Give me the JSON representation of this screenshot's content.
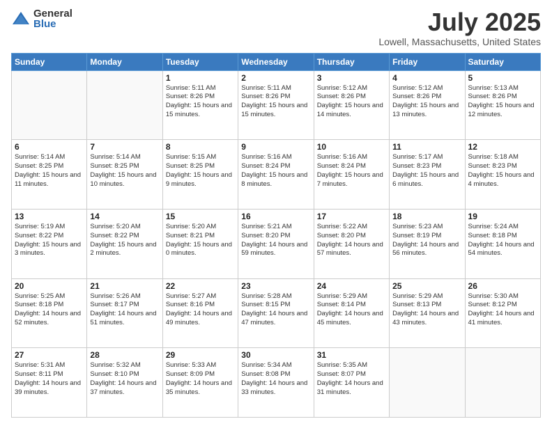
{
  "logo": {
    "general": "General",
    "blue": "Blue"
  },
  "title": "July 2025",
  "subtitle": "Lowell, Massachusetts, United States",
  "headers": [
    "Sunday",
    "Monday",
    "Tuesday",
    "Wednesday",
    "Thursday",
    "Friday",
    "Saturday"
  ],
  "weeks": [
    [
      {
        "day": "",
        "sunrise": "",
        "sunset": "",
        "daylight": ""
      },
      {
        "day": "",
        "sunrise": "",
        "sunset": "",
        "daylight": ""
      },
      {
        "day": "1",
        "sunrise": "Sunrise: 5:11 AM",
        "sunset": "Sunset: 8:26 PM",
        "daylight": "Daylight: 15 hours and 15 minutes."
      },
      {
        "day": "2",
        "sunrise": "Sunrise: 5:11 AM",
        "sunset": "Sunset: 8:26 PM",
        "daylight": "Daylight: 15 hours and 15 minutes."
      },
      {
        "day": "3",
        "sunrise": "Sunrise: 5:12 AM",
        "sunset": "Sunset: 8:26 PM",
        "daylight": "Daylight: 15 hours and 14 minutes."
      },
      {
        "day": "4",
        "sunrise": "Sunrise: 5:12 AM",
        "sunset": "Sunset: 8:26 PM",
        "daylight": "Daylight: 15 hours and 13 minutes."
      },
      {
        "day": "5",
        "sunrise": "Sunrise: 5:13 AM",
        "sunset": "Sunset: 8:26 PM",
        "daylight": "Daylight: 15 hours and 12 minutes."
      }
    ],
    [
      {
        "day": "6",
        "sunrise": "Sunrise: 5:14 AM",
        "sunset": "Sunset: 8:25 PM",
        "daylight": "Daylight: 15 hours and 11 minutes."
      },
      {
        "day": "7",
        "sunrise": "Sunrise: 5:14 AM",
        "sunset": "Sunset: 8:25 PM",
        "daylight": "Daylight: 15 hours and 10 minutes."
      },
      {
        "day": "8",
        "sunrise": "Sunrise: 5:15 AM",
        "sunset": "Sunset: 8:25 PM",
        "daylight": "Daylight: 15 hours and 9 minutes."
      },
      {
        "day": "9",
        "sunrise": "Sunrise: 5:16 AM",
        "sunset": "Sunset: 8:24 PM",
        "daylight": "Daylight: 15 hours and 8 minutes."
      },
      {
        "day": "10",
        "sunrise": "Sunrise: 5:16 AM",
        "sunset": "Sunset: 8:24 PM",
        "daylight": "Daylight: 15 hours and 7 minutes."
      },
      {
        "day": "11",
        "sunrise": "Sunrise: 5:17 AM",
        "sunset": "Sunset: 8:23 PM",
        "daylight": "Daylight: 15 hours and 6 minutes."
      },
      {
        "day": "12",
        "sunrise": "Sunrise: 5:18 AM",
        "sunset": "Sunset: 8:23 PM",
        "daylight": "Daylight: 15 hours and 4 minutes."
      }
    ],
    [
      {
        "day": "13",
        "sunrise": "Sunrise: 5:19 AM",
        "sunset": "Sunset: 8:22 PM",
        "daylight": "Daylight: 15 hours and 3 minutes."
      },
      {
        "day": "14",
        "sunrise": "Sunrise: 5:20 AM",
        "sunset": "Sunset: 8:22 PM",
        "daylight": "Daylight: 15 hours and 2 minutes."
      },
      {
        "day": "15",
        "sunrise": "Sunrise: 5:20 AM",
        "sunset": "Sunset: 8:21 PM",
        "daylight": "Daylight: 15 hours and 0 minutes."
      },
      {
        "day": "16",
        "sunrise": "Sunrise: 5:21 AM",
        "sunset": "Sunset: 8:20 PM",
        "daylight": "Daylight: 14 hours and 59 minutes."
      },
      {
        "day": "17",
        "sunrise": "Sunrise: 5:22 AM",
        "sunset": "Sunset: 8:20 PM",
        "daylight": "Daylight: 14 hours and 57 minutes."
      },
      {
        "day": "18",
        "sunrise": "Sunrise: 5:23 AM",
        "sunset": "Sunset: 8:19 PM",
        "daylight": "Daylight: 14 hours and 56 minutes."
      },
      {
        "day": "19",
        "sunrise": "Sunrise: 5:24 AM",
        "sunset": "Sunset: 8:18 PM",
        "daylight": "Daylight: 14 hours and 54 minutes."
      }
    ],
    [
      {
        "day": "20",
        "sunrise": "Sunrise: 5:25 AM",
        "sunset": "Sunset: 8:18 PM",
        "daylight": "Daylight: 14 hours and 52 minutes."
      },
      {
        "day": "21",
        "sunrise": "Sunrise: 5:26 AM",
        "sunset": "Sunset: 8:17 PM",
        "daylight": "Daylight: 14 hours and 51 minutes."
      },
      {
        "day": "22",
        "sunrise": "Sunrise: 5:27 AM",
        "sunset": "Sunset: 8:16 PM",
        "daylight": "Daylight: 14 hours and 49 minutes."
      },
      {
        "day": "23",
        "sunrise": "Sunrise: 5:28 AM",
        "sunset": "Sunset: 8:15 PM",
        "daylight": "Daylight: 14 hours and 47 minutes."
      },
      {
        "day": "24",
        "sunrise": "Sunrise: 5:29 AM",
        "sunset": "Sunset: 8:14 PM",
        "daylight": "Daylight: 14 hours and 45 minutes."
      },
      {
        "day": "25",
        "sunrise": "Sunrise: 5:29 AM",
        "sunset": "Sunset: 8:13 PM",
        "daylight": "Daylight: 14 hours and 43 minutes."
      },
      {
        "day": "26",
        "sunrise": "Sunrise: 5:30 AM",
        "sunset": "Sunset: 8:12 PM",
        "daylight": "Daylight: 14 hours and 41 minutes."
      }
    ],
    [
      {
        "day": "27",
        "sunrise": "Sunrise: 5:31 AM",
        "sunset": "Sunset: 8:11 PM",
        "daylight": "Daylight: 14 hours and 39 minutes."
      },
      {
        "day": "28",
        "sunrise": "Sunrise: 5:32 AM",
        "sunset": "Sunset: 8:10 PM",
        "daylight": "Daylight: 14 hours and 37 minutes."
      },
      {
        "day": "29",
        "sunrise": "Sunrise: 5:33 AM",
        "sunset": "Sunset: 8:09 PM",
        "daylight": "Daylight: 14 hours and 35 minutes."
      },
      {
        "day": "30",
        "sunrise": "Sunrise: 5:34 AM",
        "sunset": "Sunset: 8:08 PM",
        "daylight": "Daylight: 14 hours and 33 minutes."
      },
      {
        "day": "31",
        "sunrise": "Sunrise: 5:35 AM",
        "sunset": "Sunset: 8:07 PM",
        "daylight": "Daylight: 14 hours and 31 minutes."
      },
      {
        "day": "",
        "sunrise": "",
        "sunset": "",
        "daylight": ""
      },
      {
        "day": "",
        "sunrise": "",
        "sunset": "",
        "daylight": ""
      }
    ]
  ]
}
